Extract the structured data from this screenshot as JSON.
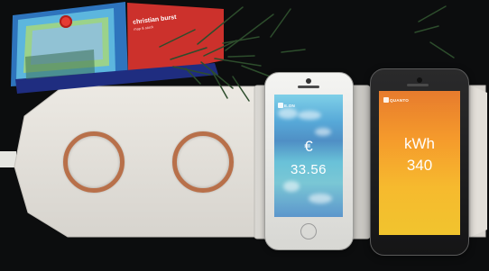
{
  "scene": {
    "book": {
      "title": "christian burst",
      "subtitle": "map & stock"
    },
    "white_phone": {
      "status_label": "e.ON",
      "currency_symbol": "€",
      "amount": "33.56"
    },
    "black_phone": {
      "status_label": "QUANTO",
      "energy_unit": "kWh",
      "energy_value": "340"
    }
  },
  "colors": {
    "background": "#0c0d0e",
    "pad": "#e3e1dc",
    "coil": "#b8704a",
    "white_phone_screen_top": "#7fd0e8",
    "black_phone_screen_top": "#e77b2d",
    "black_phone_screen_bottom": "#f1c42e"
  },
  "icons": {
    "white_phone_app": "tile-icon",
    "black_phone_app": "tile-icon",
    "logo": "badge-icon"
  }
}
